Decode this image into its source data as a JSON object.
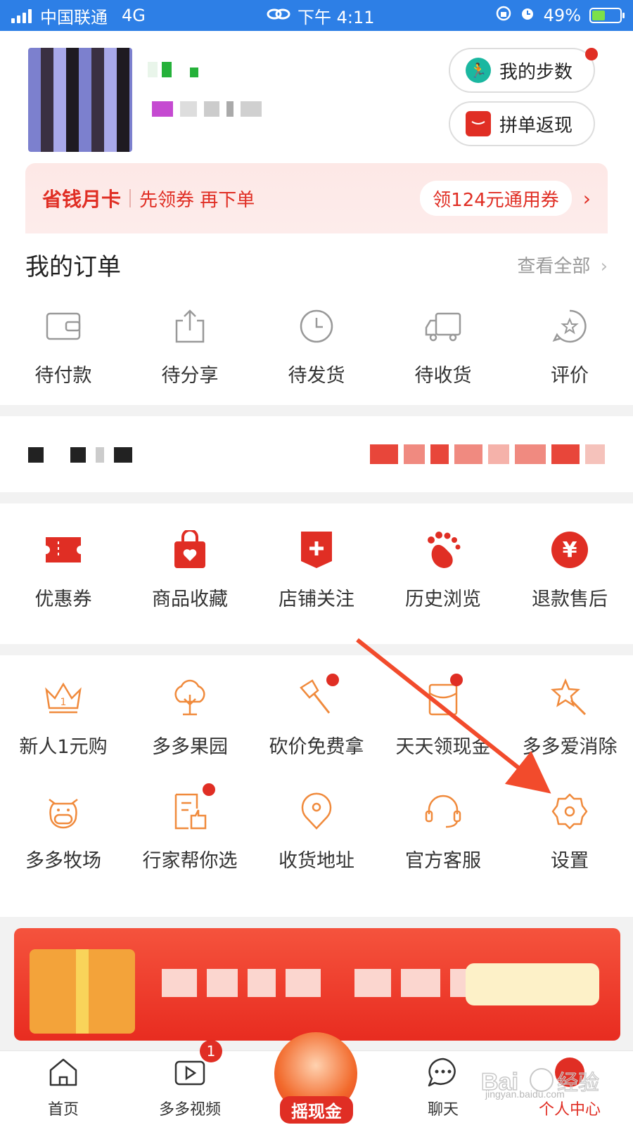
{
  "status_bar": {
    "carrier": "中国联通",
    "network": "4G",
    "time": "下午 4:11",
    "battery": "49%"
  },
  "profile": {
    "steps_button": "我的步数",
    "group_cashback_button": "拼单返现"
  },
  "savecard": {
    "title": "省钱月卡",
    "subtitle": "先领券 再下单",
    "coupon": "领124元通用券"
  },
  "orders": {
    "title": "我的订单",
    "view_all": "查看全部",
    "items": [
      {
        "label": "待付款",
        "icon": "wallet-icon"
      },
      {
        "label": "待分享",
        "icon": "share-icon"
      },
      {
        "label": "待发货",
        "icon": "clock-icon"
      },
      {
        "label": "待收货",
        "icon": "truck-icon"
      },
      {
        "label": "评价",
        "icon": "review-icon"
      }
    ]
  },
  "tools": {
    "items": [
      {
        "label": "优惠券",
        "icon": "coupon-icon"
      },
      {
        "label": "商品收藏",
        "icon": "favorite-bag-icon"
      },
      {
        "label": "店铺关注",
        "icon": "store-follow-icon"
      },
      {
        "label": "历史浏览",
        "icon": "footprint-icon"
      },
      {
        "label": "退款售后",
        "icon": "refund-icon"
      }
    ]
  },
  "services": {
    "row1": [
      {
        "label": "新人1元购",
        "icon": "crown-icon"
      },
      {
        "label": "多多果园",
        "icon": "tree-icon"
      },
      {
        "label": "砍价免费拿",
        "icon": "axe-icon"
      },
      {
        "label": "天天领现金",
        "icon": "cash-icon"
      },
      {
        "label": "多多爱消除",
        "icon": "star-wand-icon"
      }
    ],
    "row2": [
      {
        "label": "多多牧场",
        "icon": "cow-icon"
      },
      {
        "label": "行家帮你选",
        "icon": "recommend-icon"
      },
      {
        "label": "收货地址",
        "icon": "location-icon"
      },
      {
        "label": "官方客服",
        "icon": "headset-icon"
      },
      {
        "label": "设置",
        "icon": "gear-icon"
      }
    ]
  },
  "bottom_nav": {
    "items": [
      {
        "label": "首页",
        "icon": "home-icon"
      },
      {
        "label": "多多视频",
        "icon": "video-icon",
        "badge": "1"
      },
      {
        "label": "摇现金",
        "icon": "shake-cash-icon"
      },
      {
        "label": "聊天",
        "icon": "chat-icon"
      },
      {
        "label": "个人中心",
        "icon": "profile-icon"
      }
    ]
  },
  "watermark": {
    "text": "Bai 经验",
    "url": "jingyan.baidu.com"
  },
  "colors": {
    "brand_red": "#e02e24",
    "service_orange": "#f08a3c",
    "status_bar_blue": "#2d7fe6"
  }
}
